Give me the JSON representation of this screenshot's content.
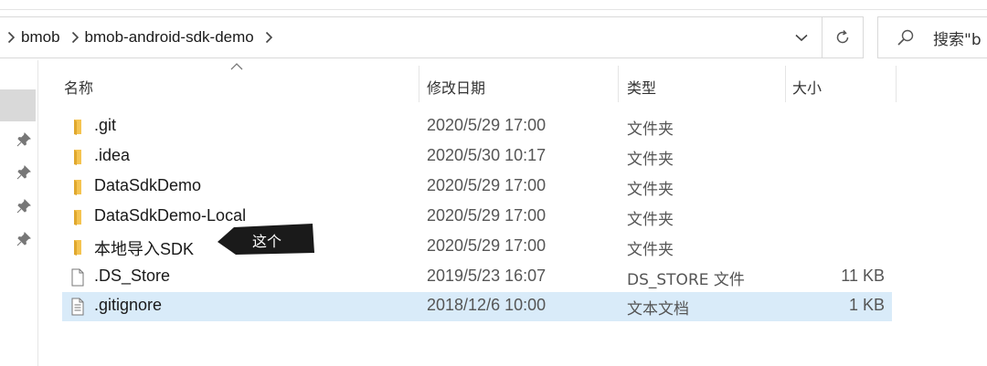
{
  "addressbar": {
    "breadcrumbs": [
      "bmob",
      "bmob-android-sdk-demo"
    ]
  },
  "search": {
    "placeholder": "搜索\"b"
  },
  "columns": {
    "name": "名称",
    "date": "修改日期",
    "type": "类型",
    "size": "大小"
  },
  "files": [
    {
      "name": ".git",
      "date": "2020/5/29 17:00",
      "type": "文件夹",
      "size": "",
      "icon": "folder-icon"
    },
    {
      "name": ".idea",
      "date": "2020/5/30 10:17",
      "type": "文件夹",
      "size": "",
      "icon": "folder-icon"
    },
    {
      "name": "DataSdkDemo",
      "date": "2020/5/29 17:00",
      "type": "文件夹",
      "size": "",
      "icon": "folder-icon"
    },
    {
      "name": "DataSdkDemo-Local",
      "date": "2020/5/29 17:00",
      "type": "文件夹",
      "size": "",
      "icon": "folder-icon"
    },
    {
      "name": "本地导入SDK",
      "date": "2020/5/29 17:00",
      "type": "文件夹",
      "size": "",
      "icon": "folder-icon"
    },
    {
      "name": ".DS_Store",
      "date": "2019/5/23 16:07",
      "type": "DS_STORE 文件",
      "size": "11 KB",
      "icon": "file-icon"
    },
    {
      "name": ".gitignore",
      "date": "2018/12/6 10:00",
      "type": "文本文档",
      "size": "1 KB",
      "icon": "text-file-icon"
    }
  ],
  "annotation": {
    "text": "这个"
  },
  "colors": {
    "folder": "#f5c451",
    "selected_row": "#d9ebf9",
    "callout": "#1a1a1a"
  }
}
